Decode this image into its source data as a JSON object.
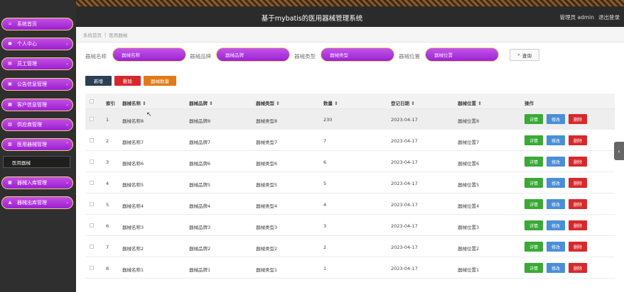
{
  "header": {
    "title": "基于mybatis的医用器械管理系统",
    "user": "管理员 admin",
    "logout": "退出登录"
  },
  "sidebar": {
    "items": [
      {
        "label": "系统首页",
        "icon": "home-icon"
      },
      {
        "label": "个人中心",
        "icon": "user-icon"
      },
      {
        "label": "员工管理",
        "icon": "staff-icon"
      },
      {
        "label": "公告信息管理",
        "icon": "notice-icon"
      },
      {
        "label": "客户信息管理",
        "icon": "customer-icon"
      },
      {
        "label": "供应商管理",
        "icon": "supplier-icon"
      },
      {
        "label": "医用器械管理",
        "icon": "device-icon"
      },
      {
        "label": "器械入库管理",
        "icon": "inbound-icon"
      },
      {
        "label": "器械出库管理",
        "icon": "outbound-icon"
      }
    ],
    "submenu_active": "医用器械"
  },
  "breadcrumb": {
    "home": "系统首页",
    "sep": "|",
    "current": "医用器械"
  },
  "search": {
    "name_label": "器械名称",
    "name_placeholder": "器械名称",
    "brand_label": "器械品牌",
    "brand_placeholder": "器械品牌",
    "type_label": "器械类型",
    "type_placeholder": "器械类型",
    "location_label": "器械位置",
    "location_placeholder": "器械位置",
    "button": "查询"
  },
  "actions": {
    "add": "新增",
    "delete": "删除",
    "count": "器械数量"
  },
  "table": {
    "headers": {
      "index": "索引",
      "name": "器械名称",
      "brand": "器械品牌",
      "type": "器械类型",
      "qty": "数量",
      "date": "登记日期",
      "location": "器械位置",
      "ops": "操作"
    },
    "rows": [
      {
        "index": "1",
        "name": "器械名称8",
        "brand": "器械品牌8",
        "type": "器械类型8",
        "qty": "230",
        "date": "2023-04-17",
        "location": "器械位置8"
      },
      {
        "index": "2",
        "name": "器械名称7",
        "brand": "器械品牌7",
        "type": "器械类型7",
        "qty": "7",
        "date": "2023-04-17",
        "location": "器械位置7"
      },
      {
        "index": "3",
        "name": "器械名称6",
        "brand": "器械品牌6",
        "type": "器械类型6",
        "qty": "6",
        "date": "2023-04-17",
        "location": "器械位置6"
      },
      {
        "index": "4",
        "name": "器械名称5",
        "brand": "器械品牌5",
        "type": "器械类型5",
        "qty": "5",
        "date": "2023-04-17",
        "location": "器械位置5"
      },
      {
        "index": "5",
        "name": "器械名称4",
        "brand": "器械品牌4",
        "type": "器械类型4",
        "qty": "4",
        "date": "2023-04-17",
        "location": "器械位置4"
      },
      {
        "index": "6",
        "name": "器械名称3",
        "brand": "器械品牌3",
        "type": "器械类型3",
        "qty": "3",
        "date": "2023-04-17",
        "location": "器械位置3"
      },
      {
        "index": "7",
        "name": "器械名称2",
        "brand": "器械品牌2",
        "type": "器械类型2",
        "qty": "2",
        "date": "2023-04-17",
        "location": "器械位置2"
      },
      {
        "index": "8",
        "name": "器械名称1",
        "brand": "器械品牌1",
        "type": "器械类型1",
        "qty": "1",
        "date": "2023-04-17",
        "location": "器械位置1"
      }
    ],
    "row_buttons": {
      "detail": "详情",
      "edit": "修改",
      "delete": "删除"
    }
  },
  "colors": {
    "menu_purple": "#9b1fd0",
    "menu_border": "#f0d27a",
    "header_bg": "#2b2b2b",
    "btn_add": "#2b3f55",
    "btn_delete": "#d8282c",
    "btn_count": "#e07b16",
    "btn_detail": "#3aa935",
    "btn_edit": "#4a8fd6"
  }
}
